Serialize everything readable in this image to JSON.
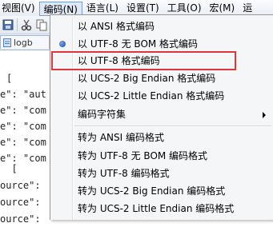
{
  "menubar": {
    "items": [
      "视图(V)",
      "编码(N)",
      "语言(L)",
      "设置(T)",
      "工具(O)",
      "宏(M)",
      "运"
    ],
    "active_index": 1
  },
  "tab": {
    "label": "logb"
  },
  "editor": {
    "lines": [
      "[",
      "e\": \"aut",
      "e\": \"com",
      "e\": \"com",
      "e\": \"com",
      "e\": \"com",
      "",
      "  [",
      "ource\":",
      "ource\":",
      "ource\":"
    ]
  },
  "encoding_menu": {
    "items": [
      {
        "label": "以 ANSI 格式编码"
      },
      {
        "label": "以 UTF-8 无 BOM 格式编码",
        "selected": true
      },
      {
        "label": "以 UTF-8 格式编码",
        "highlighted": true
      },
      {
        "label": "以 UCS-2 Big Endian 格式编码"
      },
      {
        "label": "以 UCS-2 Little Endian 格式编码"
      },
      {
        "label": "编码字符集",
        "submenu": true
      },
      {
        "label": "转为 ANSI 编码格式"
      },
      {
        "label": "转为 UTF-8 无 BOM 编码格式"
      },
      {
        "label": "转为 UTF-8 编码格式"
      },
      {
        "label": "转为 UCS-2 Big Endian 编码格式"
      },
      {
        "label": "转为 UCS-2 Little Endian 编码格式"
      }
    ]
  },
  "colors": {
    "highlight_box": "#e0353a",
    "radio_bullet": "#1d45a8",
    "menu_bg": "#f5f6f7"
  }
}
